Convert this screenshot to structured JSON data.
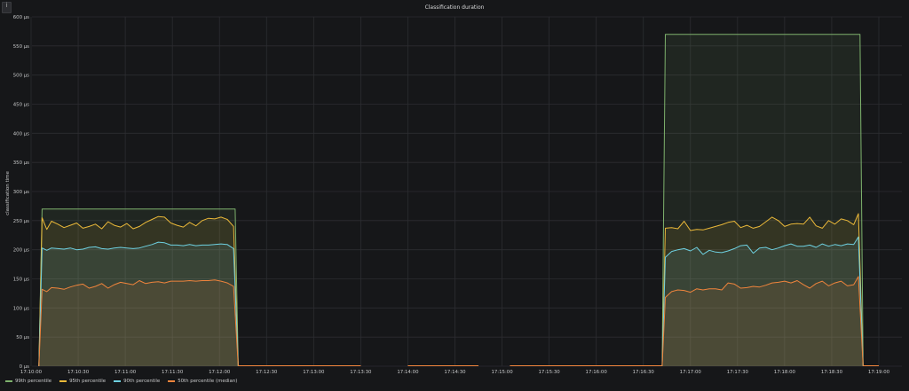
{
  "panel": {
    "menu_icon": "info-corner-icon",
    "menu_glyph": "i"
  },
  "chart_data": {
    "type": "area",
    "title": "Classification duration",
    "ylabel": "classification time",
    "xlabel": "",
    "y_unit": "µs",
    "ylim": [
      0,
      600
    ],
    "y_ticks": [
      "0 µs",
      "50 µs",
      "100 µs",
      "150 µs",
      "200 µs",
      "250 µs",
      "300 µs",
      "350 µs",
      "400 µs",
      "450 µs",
      "500 µs",
      "550 µs",
      "600 µs"
    ],
    "x_ticks": [
      "17:10:00",
      "17:10:30",
      "17:11:00",
      "17:11:30",
      "17:12:00",
      "17:12:30",
      "17:13:00",
      "17:13:30",
      "17:14:00",
      "17:14:30",
      "17:15:00",
      "17:15:30",
      "17:16:00",
      "17:16:30",
      "17:17:00",
      "17:17:30",
      "17:18:00",
      "17:18:30",
      "17:19:00"
    ],
    "grid": true,
    "legend_position": "bottom-left",
    "series": [
      {
        "name": "99th percentile",
        "color": "#7eb26d",
        "segments": [
          {
            "t": [
              "17:10:05",
              "17:10:07",
              "17:12:10",
              "17:12:12"
            ],
            "v": [
              0,
              270,
              270,
              0
            ]
          },
          {
            "t": [
              "17:16:42",
              "17:16:44",
              "17:18:48",
              "17:18:50"
            ],
            "v": [
              0,
              570,
              570,
              0
            ]
          }
        ]
      },
      {
        "name": "95th percentile",
        "color": "#eab839",
        "segments": [
          {
            "t": [
              "17:10:05",
              "17:10:07",
              "17:10:10",
              "17:10:13",
              "17:10:17",
              "17:10:21",
              "17:10:25",
              "17:10:29",
              "17:10:33",
              "17:10:37",
              "17:10:41",
              "17:10:45",
              "17:10:49",
              "17:10:53",
              "17:10:57",
              "17:11:01",
              "17:11:05",
              "17:11:09",
              "17:11:13",
              "17:11:17",
              "17:11:21",
              "17:11:25",
              "17:11:29",
              "17:11:33",
              "17:11:37",
              "17:11:41",
              "17:11:45",
              "17:11:49",
              "17:11:53",
              "17:11:57",
              "17:12:01",
              "17:12:05",
              "17:12:09",
              "17:12:12"
            ],
            "v": [
              0,
              255,
              235,
              249,
              244,
              238,
              242,
              246,
              237,
              240,
              244,
              236,
              248,
              242,
              239,
              245,
              236,
              240,
              247,
              252,
              257,
              256,
              246,
              242,
              239,
              247,
              241,
              250,
              254,
              253,
              256,
              252,
              240,
              0
            ]
          },
          {
            "t": [
              "17:16:42",
              "17:16:44",
              "17:16:48",
              "17:16:52",
              "17:16:56",
              "17:17:00",
              "17:17:04",
              "17:17:08",
              "17:17:12",
              "17:17:16",
              "17:17:20",
              "17:17:24",
              "17:17:28",
              "17:17:32",
              "17:17:36",
              "17:17:40",
              "17:17:44",
              "17:17:48",
              "17:17:52",
              "17:17:56",
              "17:18:00",
              "17:18:04",
              "17:18:08",
              "17:18:12",
              "17:18:16",
              "17:18:20",
              "17:18:24",
              "17:18:28",
              "17:18:32",
              "17:18:36",
              "17:18:40",
              "17:18:44",
              "17:18:47",
              "17:18:50"
            ],
            "v": [
              0,
              237,
              238,
              236,
              249,
              233,
              235,
              234,
              237,
              240,
              243,
              247,
              249,
              238,
              242,
              237,
              240,
              248,
              256,
              250,
              240,
              244,
              245,
              244,
              256,
              241,
              237,
              250,
              244,
              253,
              250,
              243,
              262,
              0
            ]
          }
        ]
      },
      {
        "name": "90th percentile",
        "color": "#6ed0e0",
        "segments": [
          {
            "t": [
              "17:10:05",
              "17:10:07",
              "17:10:10",
              "17:10:13",
              "17:10:17",
              "17:10:21",
              "17:10:25",
              "17:10:29",
              "17:10:33",
              "17:10:37",
              "17:10:41",
              "17:10:45",
              "17:10:49",
              "17:10:53",
              "17:10:57",
              "17:11:01",
              "17:11:05",
              "17:11:09",
              "17:11:13",
              "17:11:17",
              "17:11:21",
              "17:11:25",
              "17:11:29",
              "17:11:33",
              "17:11:37",
              "17:11:41",
              "17:11:45",
              "17:11:49",
              "17:11:53",
              "17:11:57",
              "17:12:01",
              "17:12:05",
              "17:12:09",
              "17:12:12"
            ],
            "v": [
              0,
              203,
              199,
              203,
              202,
              201,
              203,
              200,
              201,
              204,
              205,
              202,
              201,
              203,
              204,
              203,
              202,
              203,
              206,
              209,
              213,
              212,
              208,
              208,
              207,
              209,
              207,
              208,
              208,
              209,
              210,
              209,
              202,
              0
            ]
          },
          {
            "t": [
              "17:16:42",
              "17:16:44",
              "17:16:48",
              "17:16:52",
              "17:16:56",
              "17:17:00",
              "17:17:04",
              "17:17:08",
              "17:17:12",
              "17:17:16",
              "17:17:20",
              "17:17:24",
              "17:17:28",
              "17:17:32",
              "17:17:36",
              "17:17:40",
              "17:17:44",
              "17:17:48",
              "17:17:52",
              "17:17:56",
              "17:18:00",
              "17:18:04",
              "17:18:08",
              "17:18:12",
              "17:18:16",
              "17:18:20",
              "17:18:24",
              "17:18:28",
              "17:18:32",
              "17:18:36",
              "17:18:40",
              "17:18:44",
              "17:18:47",
              "17:18:50"
            ],
            "v": [
              0,
              187,
              197,
              200,
              202,
              198,
              204,
              192,
              199,
              196,
              195,
              198,
              202,
              207,
              208,
              194,
              203,
              204,
              200,
              203,
              207,
              210,
              206,
              206,
              208,
              204,
              210,
              206,
              209,
              207,
              210,
              209,
              222,
              0
            ]
          }
        ]
      },
      {
        "name": "50th percentile (median)",
        "color": "#ef843c",
        "segments": [
          {
            "t": [
              "17:10:05",
              "17:10:07",
              "17:10:10",
              "17:10:13",
              "17:10:17",
              "17:10:21",
              "17:10:25",
              "17:10:29",
              "17:10:33",
              "17:10:37",
              "17:10:41",
              "17:10:45",
              "17:10:49",
              "17:10:53",
              "17:10:57",
              "17:11:01",
              "17:11:05",
              "17:11:09",
              "17:11:13",
              "17:11:17",
              "17:11:21",
              "17:11:25",
              "17:11:29",
              "17:11:33",
              "17:11:37",
              "17:11:41",
              "17:11:45",
              "17:11:49",
              "17:11:53",
              "17:11:57",
              "17:12:01",
              "17:12:05",
              "17:12:09",
              "17:12:12"
            ],
            "v": [
              0,
              132,
              128,
              135,
              134,
              132,
              136,
              139,
              141,
              134,
              137,
              142,
              134,
              140,
              144,
              142,
              140,
              147,
              142,
              144,
              145,
              143,
              146,
              146,
              146,
              147,
              146,
              147,
              147,
              148,
              146,
              143,
              137,
              0
            ]
          },
          {
            "t": [
              "17:16:42",
              "17:16:44",
              "17:16:48",
              "17:16:52",
              "17:16:56",
              "17:17:00",
              "17:17:04",
              "17:17:08",
              "17:17:12",
              "17:17:16",
              "17:17:20",
              "17:17:24",
              "17:17:28",
              "17:17:32",
              "17:17:36",
              "17:17:40",
              "17:17:44",
              "17:17:48",
              "17:17:52",
              "17:17:56",
              "17:18:00",
              "17:18:04",
              "17:18:08",
              "17:18:12",
              "17:18:16",
              "17:18:20",
              "17:18:24",
              "17:18:28",
              "17:18:32",
              "17:18:36",
              "17:18:40",
              "17:18:44",
              "17:18:47",
              "17:18:50"
            ],
            "v": [
              0,
              118,
              128,
              131,
              130,
              127,
              133,
              131,
              133,
              133,
              131,
              143,
              141,
              134,
              135,
              137,
              136,
              139,
              143,
              144,
              146,
              143,
              147,
              140,
              134,
              142,
              146,
              138,
              143,
              146,
              138,
              140,
              154,
              0
            ]
          }
        ]
      }
    ],
    "baseline_gaps": [
      {
        "from": "17:12:12",
        "to": "17:13:30"
      },
      {
        "from": "17:14:00",
        "to": "17:14:45"
      },
      {
        "from": "17:15:05",
        "to": "17:16:42"
      },
      {
        "from": "17:18:50",
        "to": "17:19:00"
      }
    ]
  }
}
